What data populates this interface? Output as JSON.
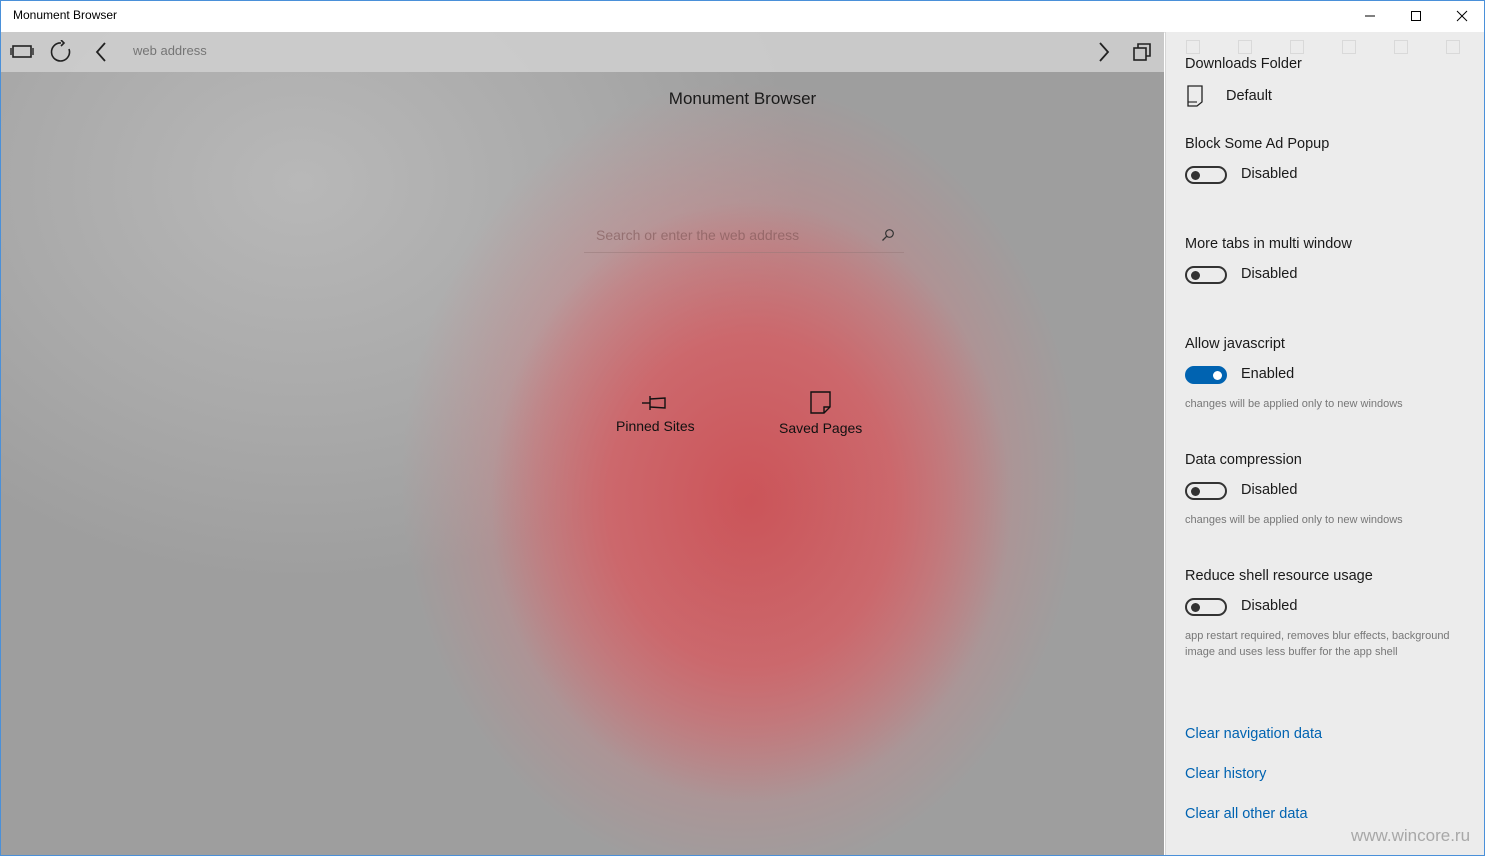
{
  "window": {
    "title": "Monument Browser",
    "minimize_icon": "minimize-icon",
    "maximize_icon": "maximize-icon",
    "close_icon": "close-icon"
  },
  "toolbar": {
    "address_placeholder": "web address",
    "icons": [
      "tabs-panel-icon",
      "refresh-icon",
      "back-icon",
      "forward-icon",
      "windows-icon"
    ]
  },
  "home": {
    "title": "Monument Browser",
    "search_placeholder": "Search or enter the web address",
    "shortcuts": [
      {
        "label": "Pinned Sites",
        "icon": "pin-icon"
      },
      {
        "label": "Saved Pages",
        "icon": "saved-page-icon"
      }
    ]
  },
  "settings": {
    "downloads": {
      "title": "Downloads Folder",
      "value": "Default"
    },
    "block_popup": {
      "title": "Block Some Ad Popup",
      "state": "Disabled",
      "on": false
    },
    "more_tabs": {
      "title": "More tabs in multi window",
      "state": "Disabled",
      "on": false
    },
    "javascript": {
      "title": "Allow javascript",
      "state": "Enabled",
      "on": true,
      "note": "changes will be applied only to new windows"
    },
    "data_compression": {
      "title": "Data compression",
      "state": "Disabled",
      "on": false,
      "note": "changes will be applied only to new windows"
    },
    "reduce_shell": {
      "title": "Reduce shell resource usage",
      "state": "Disabled",
      "on": false,
      "note": "app restart required, removes blur effects, background image and uses less buffer for the app shell"
    },
    "links": {
      "clear_navigation": "Clear navigation data",
      "clear_history": "Clear history",
      "clear_other": "Clear all other data"
    },
    "accent_color": "#0063b1"
  },
  "watermark": "www.wincore.ru"
}
